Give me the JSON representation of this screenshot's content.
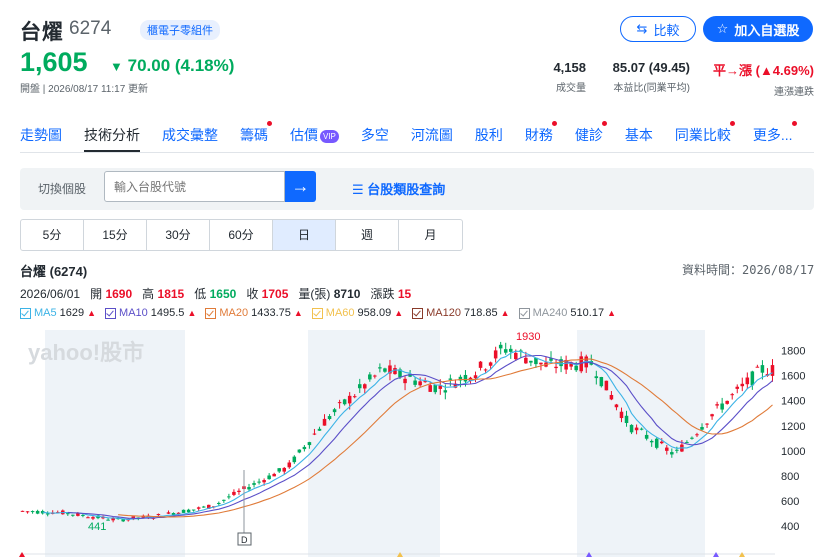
{
  "header": {
    "name": "台燿",
    "code": "6274",
    "tag": "櫃電子零組件",
    "compare_label": "比較",
    "add_watch_label": "加入自選股"
  },
  "quote": {
    "price": "1,605",
    "change": "70.00 (4.18%)",
    "update_time": "開盤 | 2026/08/17 11:17 更新",
    "volume": "4,158",
    "volume_label": "成交量",
    "pe": "85.07 (49.45)",
    "pe_label": "本益比(同業平均)",
    "streak": "平→漲 (▲4.69%)",
    "streak_label": "連漲連跌"
  },
  "nav": [
    {
      "label": "走勢圖",
      "dot": false
    },
    {
      "label": "技術分析",
      "dot": false,
      "active": true
    },
    {
      "label": "成交彙整",
      "dot": false
    },
    {
      "label": "籌碼",
      "dot": true
    },
    {
      "label": "估價",
      "dot": false,
      "vip": "VIP"
    },
    {
      "label": "多空",
      "dot": false
    },
    {
      "label": "河流圖",
      "dot": false
    },
    {
      "label": "股利",
      "dot": false
    },
    {
      "label": "財務",
      "dot": true
    },
    {
      "label": "健診",
      "dot": true
    },
    {
      "label": "基本",
      "dot": false
    },
    {
      "label": "同業比較",
      "dot": true
    },
    {
      "label": "更多...",
      "dot": true
    }
  ],
  "search": {
    "label": "切換個股",
    "placeholder": "輸入台股代號",
    "category_link": "台股類股查詢"
  },
  "periods": [
    "5分",
    "15分",
    "30分",
    "60分",
    "日",
    "週",
    "月"
  ],
  "active_period": "日",
  "chart_header": {
    "title": "台燿 (6274)",
    "data_time": "資料時間：2026/08/17",
    "date": "2026/06/01",
    "open_label": "開",
    "open": "1690",
    "high_label": "高",
    "high": "1815",
    "low_label": "低",
    "low": "1650",
    "close_label": "收",
    "close": "1705",
    "vol_label": "量(張)",
    "vol": "8710",
    "chg_label": "漲跌",
    "chg": "15"
  },
  "ma": [
    {
      "name": "MA5",
      "value": "1629",
      "color": "#3cb3e6"
    },
    {
      "name": "MA10",
      "value": "1495.5",
      "color": "#5b4fc8"
    },
    {
      "name": "MA20",
      "value": "1433.75",
      "color": "#e07b39"
    },
    {
      "name": "MA60",
      "value": "958.09",
      "color": "#f2c14e"
    },
    {
      "name": "MA120",
      "value": "718.85",
      "color": "#8a3b2a"
    },
    {
      "name": "MA240",
      "value": "510.17",
      "color": "#8e959c"
    }
  ],
  "chart_data": {
    "type": "candlestick",
    "watermark": "yahoo!股市",
    "y_ticks": [
      1800,
      1600,
      1400,
      1200,
      1000,
      800,
      600,
      400
    ],
    "ylim": [
      330,
      1900
    ],
    "annotations": {
      "max": "1930",
      "min": "441"
    },
    "marker": "D",
    "colors": {
      "up": "#eb0f29",
      "down": "#00ab5e",
      "band": "#eef3f8"
    }
  }
}
